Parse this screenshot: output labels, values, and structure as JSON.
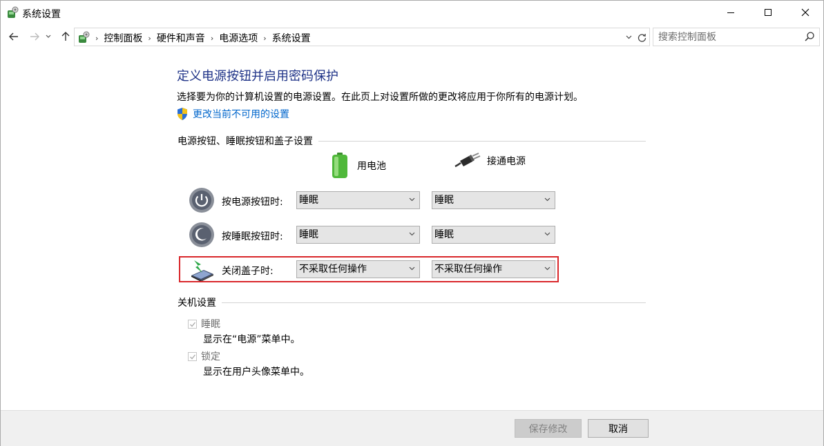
{
  "window": {
    "title": "系统设置"
  },
  "nav": {
    "breadcrumbs": [
      "控制面板",
      "硬件和声音",
      "电源选项",
      "系统设置"
    ],
    "search_placeholder": "搜索控制面板"
  },
  "main": {
    "title": "定义电源按钮并启用密码保护",
    "description": "选择要为你的计算机设置的电源设置。在此页上对设置所做的更改将应用于你所有的电源计划。",
    "admin_link": "更改当前不可用的设置",
    "power_section": {
      "heading": "电源按钮、睡眠按钮和盖子设置",
      "columns": [
        "用电池",
        "接通电源"
      ],
      "rows": [
        {
          "label": "按电源按钮时:",
          "battery": "睡眠",
          "plugged": "睡眠"
        },
        {
          "label": "按睡眠按钮时:",
          "battery": "睡眠",
          "plugged": "睡眠"
        },
        {
          "label": "关闭盖子时:",
          "battery": "不采取任何操作",
          "plugged": "不采取任何操作"
        }
      ]
    },
    "shutdown_section": {
      "heading": "关机设置",
      "items": [
        {
          "label": "睡眠",
          "description": "显示在“电源”菜单中。",
          "checked": true,
          "enabled": false
        },
        {
          "label": "锁定",
          "description": "显示在用户头像菜单中。",
          "checked": true,
          "enabled": false
        }
      ]
    }
  },
  "footer": {
    "save_label": "保存修改",
    "cancel_label": "取消"
  },
  "colors": {
    "title": "#1e3287",
    "link": "#0066cc",
    "highlight": "#d9262a"
  }
}
